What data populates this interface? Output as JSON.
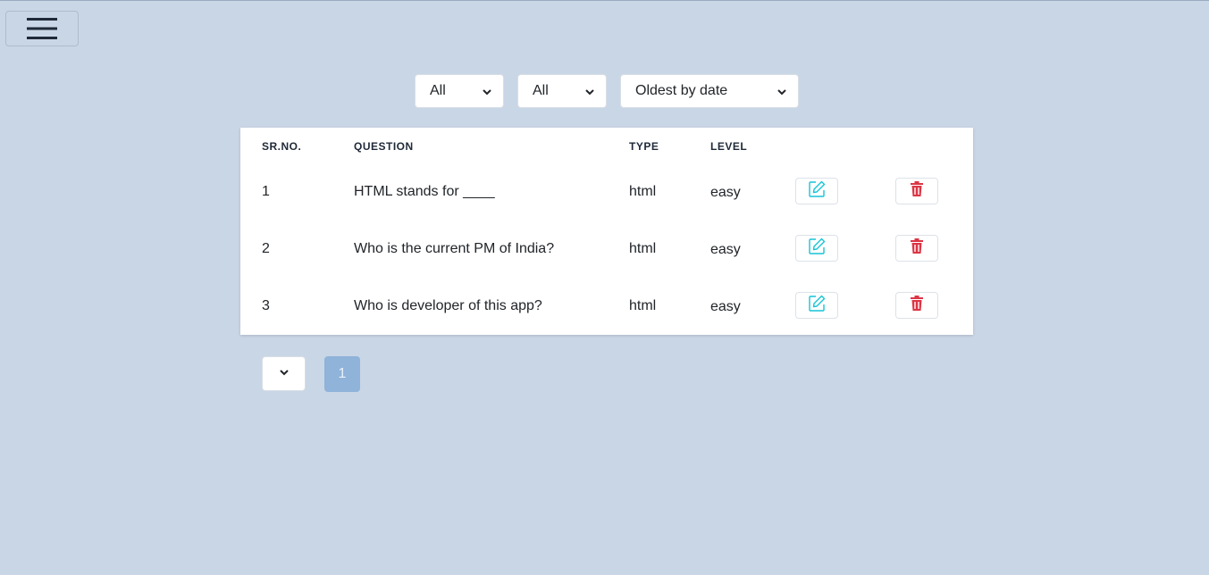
{
  "menu": {
    "icon": "hamburger-icon"
  },
  "filters": {
    "type_filter": {
      "value": "All"
    },
    "level_filter": {
      "value": "All"
    },
    "sort": {
      "value": "Oldest by date"
    }
  },
  "table": {
    "headers": [
      "SR.NO.",
      "QUESTION",
      "TYPE",
      "LEVEL"
    ],
    "rows": [
      {
        "sr": "1",
        "question": "HTML stands for ____",
        "type": "html",
        "level": "easy"
      },
      {
        "sr": "2",
        "question": "Who is the current PM of India?",
        "type": "html",
        "level": "easy"
      },
      {
        "sr": "3",
        "question": "Who is developer of this app?",
        "type": "html",
        "level": "easy"
      }
    ],
    "actions": {
      "edit_icon": "edit-icon",
      "delete_icon": "trash-icon"
    }
  },
  "pagination": {
    "current_page": "1"
  },
  "colors": {
    "background": "#c9d6e6",
    "edit": "#17c4d6",
    "delete": "#dc3545",
    "page_active": "#8fb3d9"
  }
}
